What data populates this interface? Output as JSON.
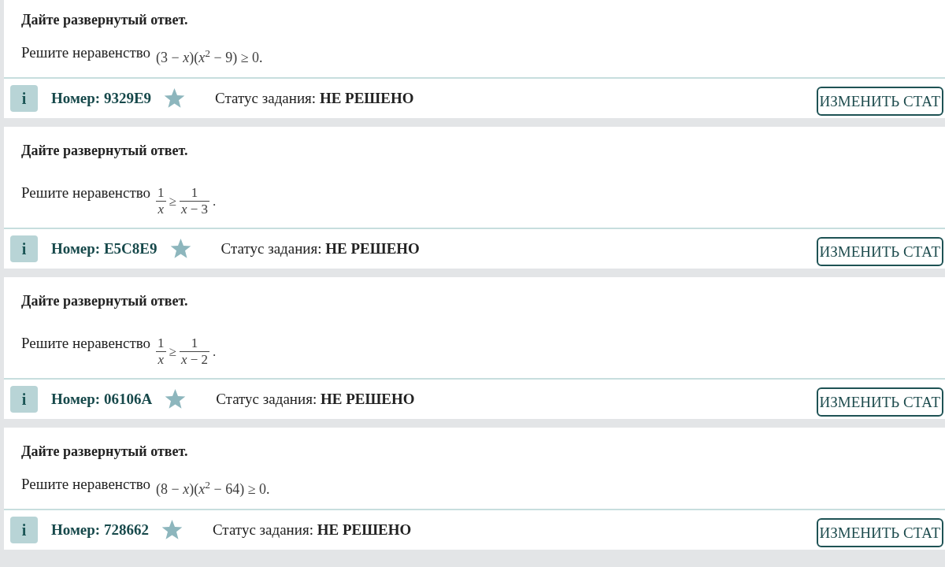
{
  "tasks": [
    {
      "prompt": "Дайте развернутый ответ.",
      "statement": "Решите неравенство",
      "formula": {
        "kind": "inline",
        "text": "(3 − *x*)(*x*$^{2}$ − 9) ≥ 0."
      },
      "info": "i",
      "number": "Номер: 9329E9",
      "starred": false,
      "status": "Статус задания: **НЕ РЕШЕНО**",
      "button": "ИЗМЕНИТЬ СТАТ"
    },
    {
      "prompt": "Дайте развернутый ответ.",
      "statement": "Решите неравенство",
      "formula": {
        "kind": "fraction_inequality",
        "left": {
          "numerator": "1",
          "denominator": "*x*"
        },
        "relation": "≥",
        "right": {
          "numerator": "1",
          "denominator": "*x* − 3"
        },
        "end": "."
      },
      "info": "i",
      "number": "Номер: E5C8E9",
      "starred": false,
      "status": "Статус задания: **НЕ РЕШЕНО**",
      "button": "ИЗМЕНИТЬ СТАТ"
    },
    {
      "prompt": "Дайте развернутый ответ.",
      "statement": "Решите неравенство",
      "formula": {
        "kind": "fraction_inequality",
        "left": {
          "numerator": "1",
          "denominator": "*x*"
        },
        "relation": "≥",
        "right": {
          "numerator": "1",
          "denominator": "*x* − 2"
        },
        "end": "."
      },
      "info": "i",
      "number": "Номер: 06106A",
      "starred": false,
      "status": "Статус задания: **НЕ РЕШЕНО**",
      "button": "ИЗМЕНИТЬ СТАТ"
    },
    {
      "prompt": "Дайте развернутый ответ.",
      "statement": "Решите неравенство",
      "formula": {
        "kind": "inline",
        "text": "(8 − *x*)(*x*$^{2}$ − 64) ≥ 0."
      },
      "info": "i",
      "number": "Номер: 728662",
      "starred": false,
      "status": "Статус задания: **НЕ РЕШЕНО**",
      "button": "ИЗМЕНИТЬ СТАТ"
    }
  ]
}
